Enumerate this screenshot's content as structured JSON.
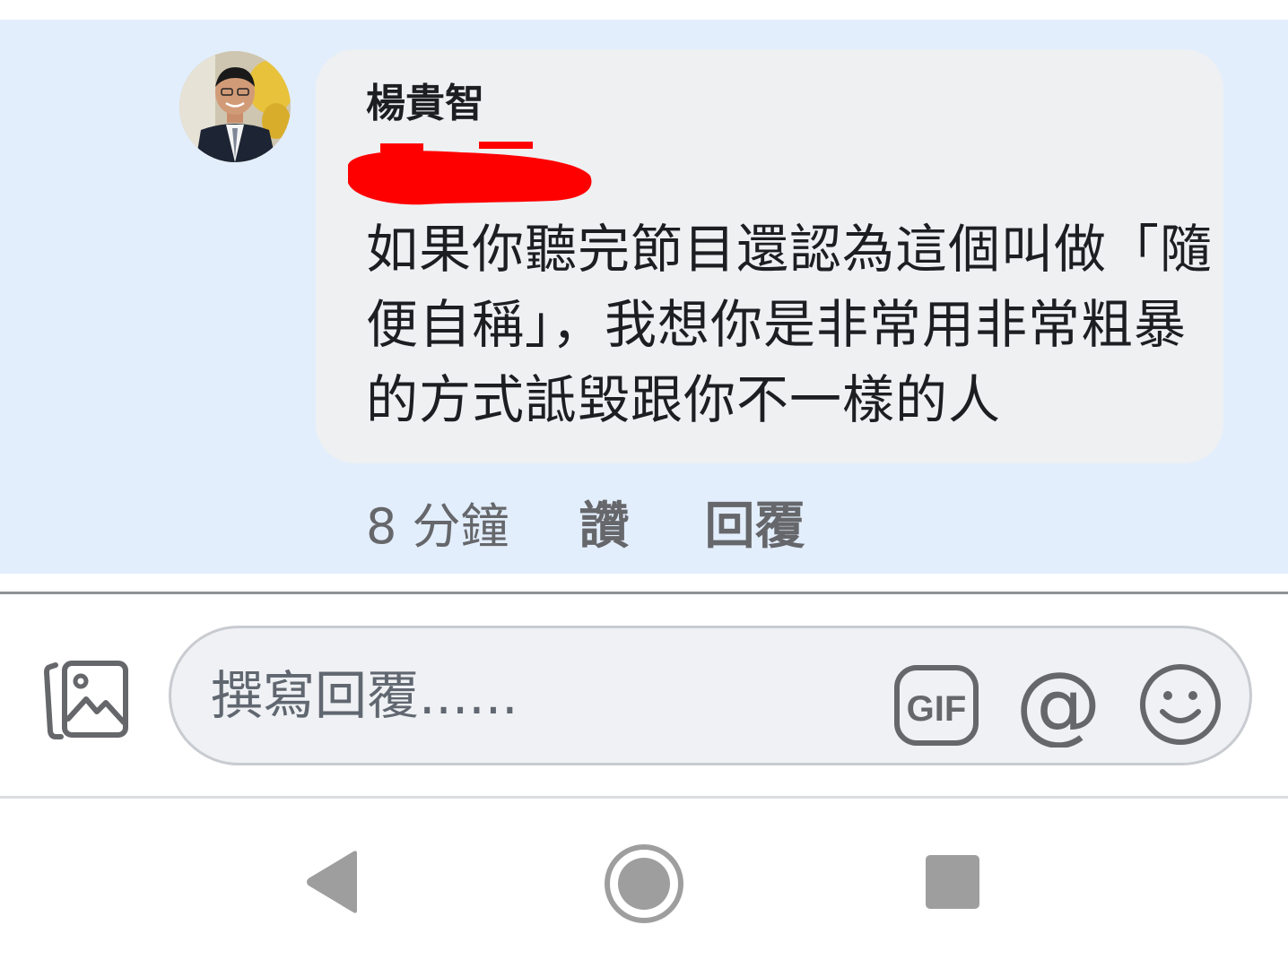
{
  "comment": {
    "author": "楊貴智",
    "text_lines": [
      "如果你聽完節目還認為這個叫做「隨",
      "便自稱」，我想你是非常用非常粗暴",
      "的方式詆毀跟你不一樣的人"
    ],
    "timestamp": "8 分鐘",
    "like_label": "讚",
    "reply_label": "回覆"
  },
  "composer": {
    "placeholder": "撰寫回覆......",
    "gif_label": "GIF",
    "mention_symbol": "@",
    "icons": [
      "photo-icon",
      "gif-icon",
      "at-icon",
      "emoji-icon"
    ]
  },
  "navigation": {
    "icons": [
      "back-icon",
      "home-icon",
      "recent-apps-icon"
    ]
  },
  "colors": {
    "highlight_background": "#e3eefc",
    "bubble_background": "#eef0f2",
    "redaction": "#ff0000",
    "secondary_text": "#65676b"
  }
}
